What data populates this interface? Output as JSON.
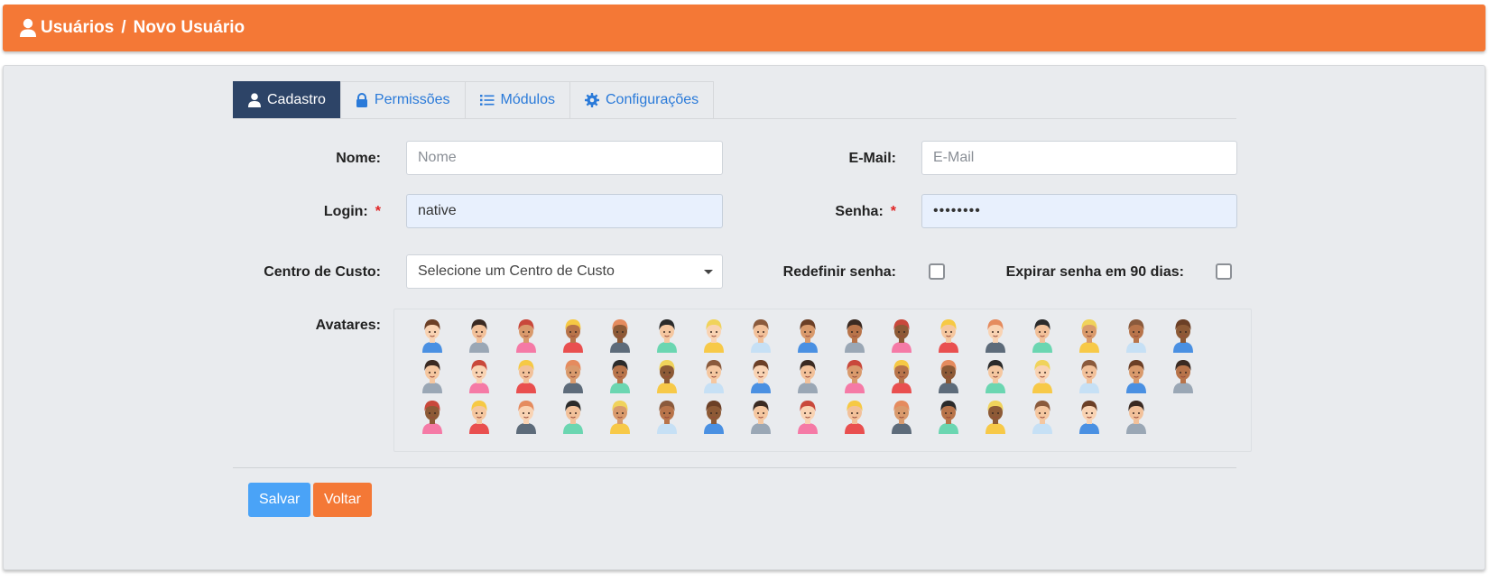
{
  "header": {
    "section": "Usuários",
    "separator": "/",
    "page": "Novo Usuário",
    "icon": "user-icon",
    "color": "#f47836"
  },
  "tabs": [
    {
      "label": "Cadastro",
      "icon": "user-icon",
      "active": true
    },
    {
      "label": "Permissões",
      "icon": "lock-icon",
      "active": false
    },
    {
      "label": "Módulos",
      "icon": "list-icon",
      "active": false
    },
    {
      "label": "Configurações",
      "icon": "gear-icon",
      "active": false
    }
  ],
  "form": {
    "nome": {
      "label": "Nome:",
      "value": "",
      "placeholder": "Nome"
    },
    "email": {
      "label": "E-Mail:",
      "value": "",
      "placeholder": "E-Mail"
    },
    "login": {
      "label": "Login:",
      "required_mark": "*",
      "value": "native"
    },
    "senha": {
      "label": "Senha:",
      "required_mark": "*",
      "value": "••••••••"
    },
    "centro_custo": {
      "label": "Centro de Custo:",
      "selected": "Selecione um Centro de Custo"
    },
    "redefinir_senha": {
      "label": "Redefinir senha:",
      "checked": false
    },
    "expirar_senha": {
      "label": "Expirar senha em 90 dias:",
      "checked": false
    },
    "avatares": {
      "label": "Avatares:",
      "rows": [
        17,
        17,
        16
      ]
    }
  },
  "actions": {
    "save": "Salvar",
    "back": "Voltar"
  },
  "colors": {
    "accent": "#f47836",
    "active_tab": "#2d4467",
    "save_button": "#4aa3f7",
    "link": "#2a7ad9"
  }
}
